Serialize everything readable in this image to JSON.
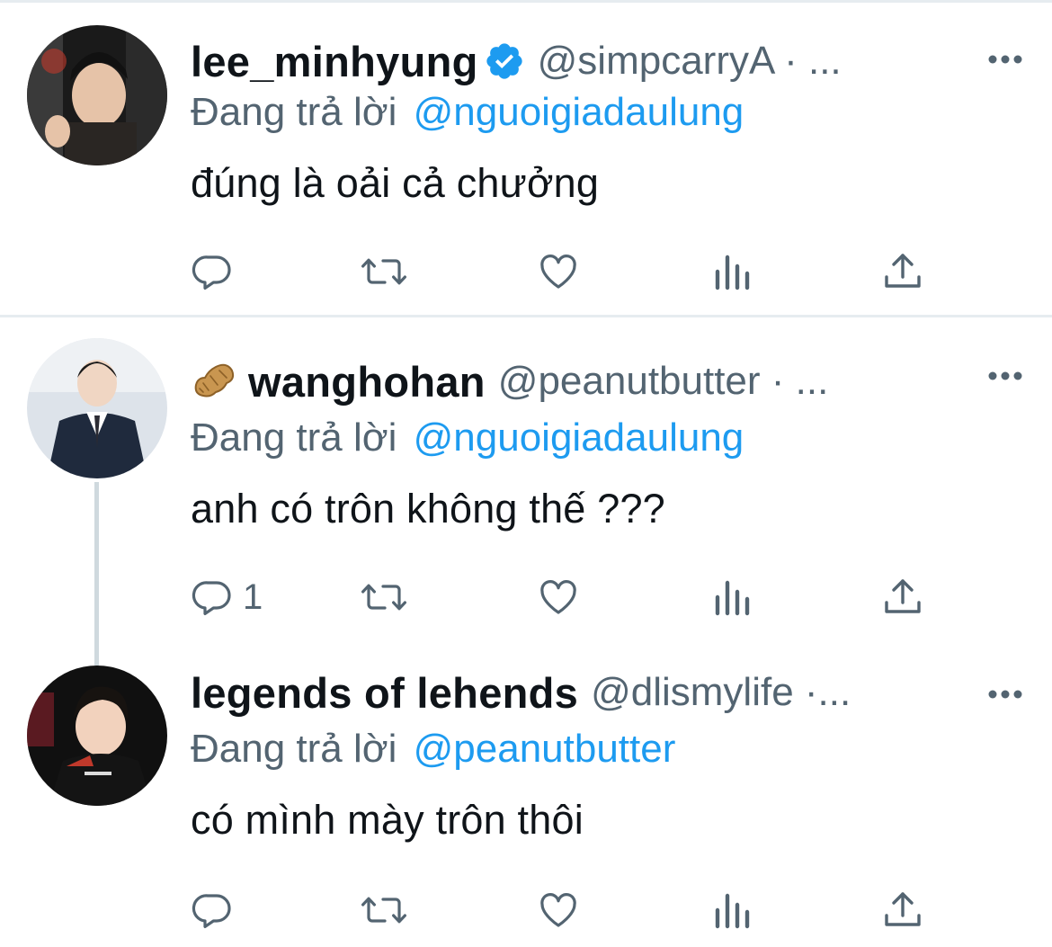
{
  "tweets": [
    {
      "display_name": "lee_minhyung",
      "handle": "@simpcarryA · ...",
      "verified": true,
      "reply_prefix": "Đang trả lời",
      "reply_to": "@nguoigiadaulung",
      "text": "đúng là oải cả chưởng",
      "reply_count": ""
    },
    {
      "display_name": "wanghohan",
      "name_emoji": "peanut-icon",
      "handle": "@peanutbutter · ...",
      "reply_prefix": "Đang trả lời",
      "reply_to": "@nguoigiadaulung",
      "text": "anh có trôn không thế ???",
      "reply_count": "1"
    },
    {
      "display_name": "legends of lehends",
      "handle": "@dlismylife ·...",
      "reply_prefix": "Đang trả lời",
      "reply_to": "@peanutbutter",
      "text": "có mình mày trôn thôi",
      "reply_count": ""
    }
  ],
  "colors": {
    "text_primary": "#0f1419",
    "text_secondary": "#536471",
    "link": "#1d9bf0",
    "verified": "#1d9bf0",
    "divider": "#e6ecf0"
  },
  "icons": {
    "reply": "reply-icon",
    "retweet": "retweet-icon",
    "like": "heart-icon",
    "analytics": "analytics-icon",
    "share": "share-icon",
    "more": "more-icon"
  }
}
